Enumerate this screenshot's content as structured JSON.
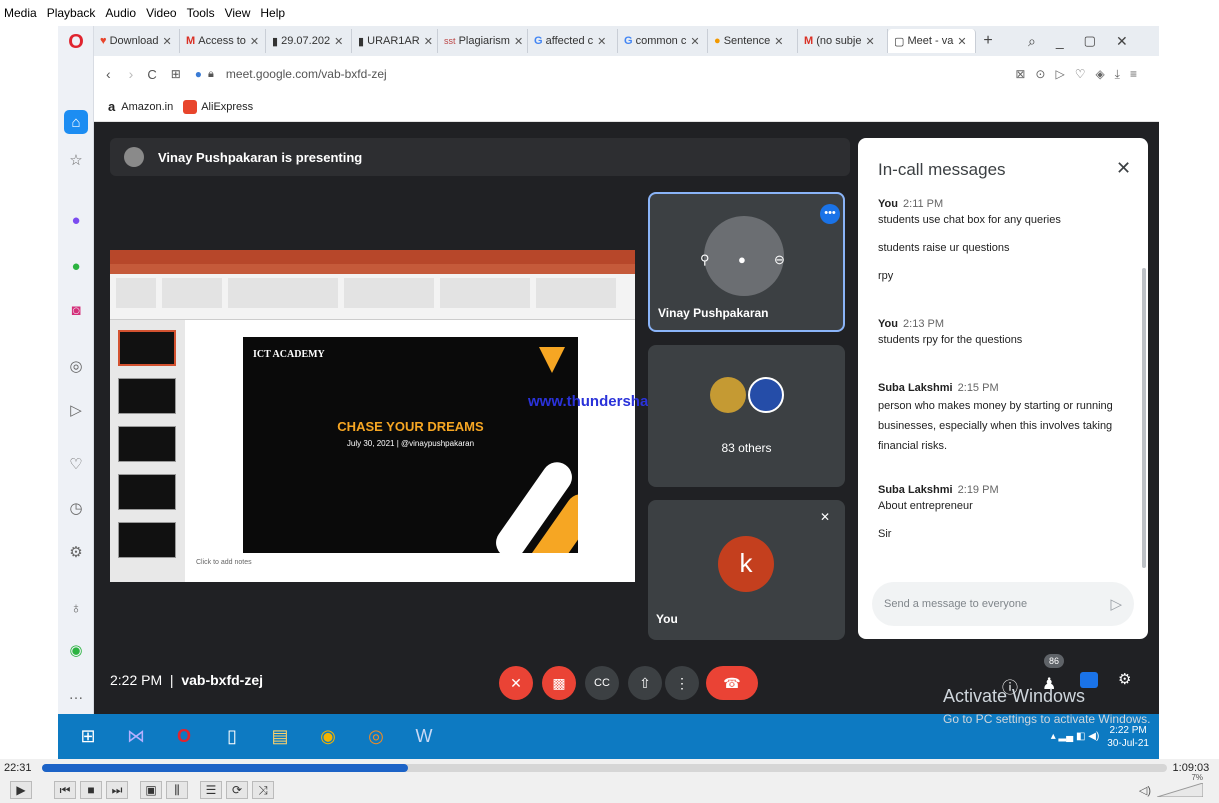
{
  "vlc_menu": [
    "Media",
    "Playback",
    "Audio",
    "Video",
    "Tools",
    "View",
    "Help"
  ],
  "browser": {
    "tabs": [
      {
        "label": "Download",
        "active": false
      },
      {
        "label": "Access to",
        "active": false
      },
      {
        "label": "29.07.202",
        "active": false
      },
      {
        "label": "URAR1AR",
        "active": false
      },
      {
        "label": "Plagiarism",
        "active": false
      },
      {
        "label": "affected c",
        "active": false
      },
      {
        "label": "common c",
        "active": false
      },
      {
        "label": "Sentence",
        "active": false
      },
      {
        "label": "(no subje",
        "active": false
      },
      {
        "label": "Meet - va",
        "active": true
      }
    ],
    "url": "meet.google.com/vab-bxfd-zej",
    "bookmarks": [
      "Amazon.in",
      "AliExpress"
    ]
  },
  "meet": {
    "presenting_banner": "Vinay Pushpakaran is presenting",
    "slide": {
      "brand": "ICT ACADEMY",
      "headline": "CHASE YOUR DREAMS",
      "subline": "July 30, 2021  |  @vinaypushpakaran",
      "notes_placeholder": "Click to add notes"
    },
    "watermark": "www.thundershare.net",
    "tiles": {
      "presenter_name": "Vinay Pushpakaran",
      "others_label": "83 others",
      "self_label": "You",
      "self_initial": "k"
    },
    "footer": {
      "time": "2:22 PM",
      "code": "vab-bxfd-zej",
      "participants_badge": "86"
    },
    "chat": {
      "title": "In-call messages",
      "messages": [
        {
          "sender": "You",
          "time": "2:11 PM",
          "lines": [
            "students use chat box for any queries",
            "students raise ur questions",
            "rpy"
          ]
        },
        {
          "sender": "You",
          "time": "2:13 PM",
          "lines": [
            "students rpy for the questions"
          ]
        },
        {
          "sender": "Suba Lakshmi",
          "time": "2:15 PM",
          "lines": [
            "person who makes money by starting or running businesses, especially when this involves taking financial risks."
          ]
        },
        {
          "sender": "Suba Lakshmi",
          "time": "2:19 PM",
          "lines": [
            "About entrepreneur",
            "Sir"
          ]
        }
      ],
      "input_placeholder": "Send a message to everyone"
    }
  },
  "windows": {
    "activate_title": "Activate Windows",
    "activate_sub": "Go to PC settings to activate Windows.",
    "clock_time": "2:22 PM",
    "clock_date": "30-Jul-21"
  },
  "player": {
    "elapsed": "22:31",
    "total": "1:09:03",
    "progress": 0.326,
    "volume_label": "7%"
  },
  "colors": {
    "meet_bg": "#202124",
    "tile_bg": "#3c4043",
    "red": "#ea4335",
    "blue": "#1a73e8",
    "taskbar": "#0d7ac2",
    "slide_orange": "#f6a623"
  }
}
